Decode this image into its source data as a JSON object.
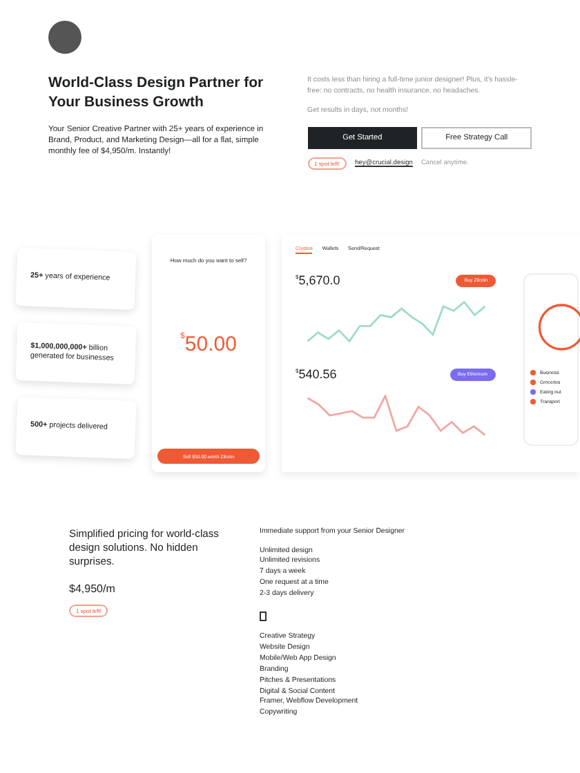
{
  "hero": {
    "title": "World-Class Design Partner for Your Business Growth",
    "intro": "Your Senior Creative Partner with 25+ years of experience in Brand, Product, and Marketing Design—all for a flat, simple monthly fee of $4,950/m. Instantly!",
    "pitch": "It costs less than hiring a full-time junior designer! Plus, it's hassle-free: no contracts, no health insurance, no headaches.",
    "tagline": "Get results in days, not months!",
    "buttons": [
      {
        "label": "Get Started",
        "kind": "primary"
      },
      {
        "label": "Free Strategy Call",
        "kind": "outline"
      }
    ],
    "badge": "1 spot left!",
    "email": "hey@crucial.design",
    "note": "Cancel anytime."
  },
  "stats": [
    {
      "value": "25+",
      "text": "years of experience"
    },
    {
      "value": "$1,000,000,000+",
      "text": "billion generated for businesses"
    },
    {
      "value": "500+",
      "text": "projects delivered"
    }
  ],
  "phone": {
    "question": "How much do you want to sell?",
    "currency": "$",
    "amount": "50.00",
    "action": "Sell $50.00 worth Zilcoin"
  },
  "dashboard": {
    "tabs": [
      {
        "label": "Cryptos",
        "selected": true
      },
      {
        "label": "Wallets",
        "selected": false
      },
      {
        "label": "Send/Request",
        "selected": false
      }
    ],
    "assets": [
      {
        "currency": "$",
        "price": "5,670.0",
        "action": "Buy Zilcoin",
        "kind": "rising",
        "color": "#ef5a36"
      },
      {
        "currency": "$",
        "price": "540.56",
        "action": "Buy Ethereum",
        "kind": "falling",
        "color": "#7b6cf0"
      }
    ],
    "categories": [
      {
        "label": "Business",
        "color": "#ef5a36"
      },
      {
        "label": "Groceries",
        "color": "#ef5a36"
      },
      {
        "label": "Eating out",
        "color": "#7b6cf0"
      },
      {
        "label": "Transport",
        "color": "#ef5a36"
      }
    ]
  },
  "pricing": {
    "headline": "Simplified pricing for world-class design solutions. No hidden surprises.",
    "price": "$4,950/m",
    "badge": "1 spot left!",
    "support": "Immediate support from your Senior Designer",
    "terms": [
      "Unlimited design",
      "Unlimited revisions",
      "7 days a week",
      "One request at a time",
      "2-3 days delivery"
    ],
    "services": [
      "Creative Strategy",
      "Website Design",
      "Mobile/Web App Design",
      "Branding",
      "Pitches & Presentations",
      "Digital & Social Content",
      "Framer, Webflow Development",
      "Copywriting"
    ]
  }
}
